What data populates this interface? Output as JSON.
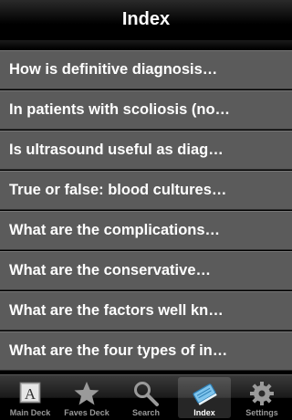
{
  "nav": {
    "title": "Index"
  },
  "list": {
    "items": [
      "How is definitive diagnosis…",
      "In patients with scoliosis (no…",
      "Is ultrasound useful as diag…",
      "True or false: blood cultures…",
      "What are the complications…",
      "What are the conservative…",
      "What are the factors well kn…",
      "What are the four types of in…"
    ]
  },
  "tabs": [
    {
      "label": "Main Deck",
      "icon": "letter-a-icon"
    },
    {
      "label": "Faves Deck",
      "icon": "star-icon"
    },
    {
      "label": "Search",
      "icon": "magnifier-icon"
    },
    {
      "label": "Index",
      "icon": "book-icon",
      "selected": true
    },
    {
      "label": "Settings",
      "icon": "gear-icon"
    }
  ]
}
